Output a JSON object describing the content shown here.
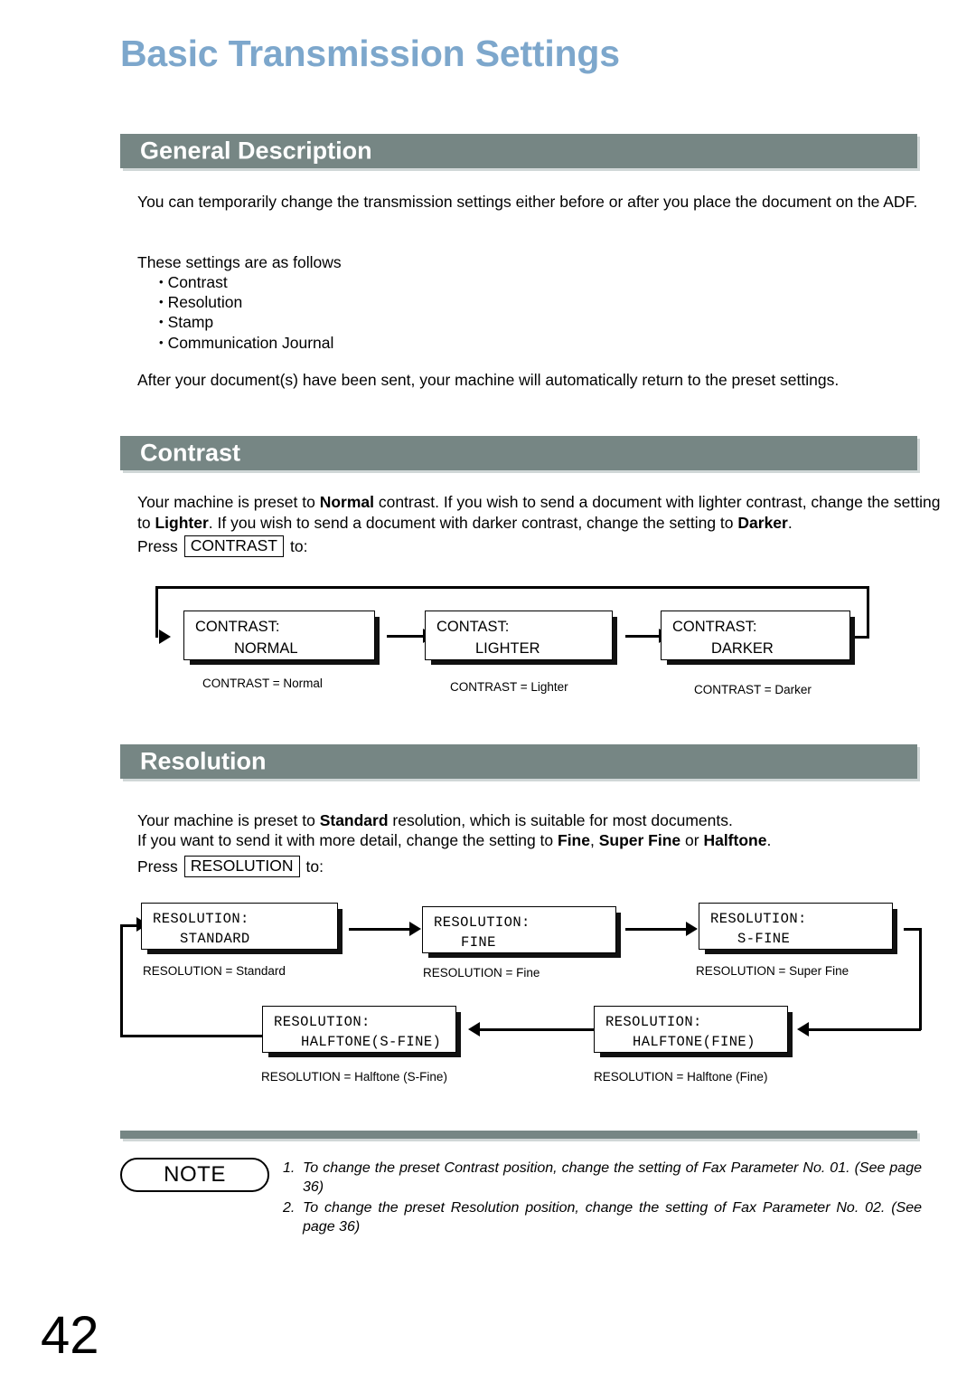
{
  "document": {
    "title": "Basic Transmission Settings",
    "page_number": "42",
    "accent_title_color": "#7da7cc",
    "section_bar_color": "#768684"
  },
  "sections": {
    "general_description": {
      "heading": "General Description",
      "paragraph1": "You can temporarily change the transmission settings either before or after you place the document on the ADF.",
      "paragraph2": "These settings are as follows",
      "bullets": [
        "Contrast",
        "Resolution",
        "Stamp",
        "Communication Journal"
      ],
      "paragraph3": "After your document(s) have been sent, your machine will automatically return to the preset settings."
    },
    "contrast": {
      "heading": "Contrast",
      "body_part1": "Your machine is preset to ",
      "body_bold1": "Normal",
      "body_part2": " contrast.  If you wish to send a document with lighter contrast, change the setting to ",
      "body_bold2": "Lighter",
      "body_part3": ".  If you wish to send a document with darker contrast, change the setting to ",
      "body_bold3": "Darker",
      "body_part4": ".",
      "press_prefix": "Press",
      "key_label": "CONTRAST",
      "press_suffix": "to:",
      "boxes": [
        {
          "line1": "CONTRAST:",
          "line2": "NORMAL",
          "caption": "CONTRAST = Normal"
        },
        {
          "line1": "CONTAST:",
          "line2": "LIGHTER",
          "caption": "CONTRAST = Lighter"
        },
        {
          "line1": "CONTRAST:",
          "line2": "DARKER",
          "caption": "CONTRAST = Darker"
        }
      ]
    },
    "resolution": {
      "heading": "Resolution",
      "body_line1_part1": "Your machine is preset to ",
      "body_line1_bold": "Standard",
      "body_line1_part2": " resolution, which is suitable for most documents.",
      "body_line2_part1": "If you want to send it with more detail, change the setting to ",
      "body_line2_bold1": "Fine",
      "body_line2_part2": ", ",
      "body_line2_bold2": "Super Fine",
      "body_line2_part3": " or ",
      "body_line2_bold3": "Halftone",
      "body_line2_part4": ".",
      "press_prefix": "Press",
      "key_label": "RESOLUTION",
      "press_suffix": "to:",
      "boxes": [
        {
          "line1": "RESOLUTION:",
          "line2": "STANDARD",
          "caption": "RESOLUTION = Standard"
        },
        {
          "line1": "RESOLUTION:",
          "line2": "FINE",
          "caption": "RESOLUTION = Fine"
        },
        {
          "line1": "RESOLUTION:",
          "line2": "S-FINE",
          "caption": "RESOLUTION = Super Fine"
        },
        {
          "line1": "RESOLUTION:",
          "line2": "HALFTONE(FINE)",
          "caption": "RESOLUTION = Halftone (Fine)"
        },
        {
          "line1": "RESOLUTION:",
          "line2": "HALFTONE(S-FINE)",
          "caption": "RESOLUTION = Halftone (S-Fine)"
        }
      ]
    }
  },
  "note": {
    "badge_label": "NOTE",
    "items": [
      {
        "num": "1.",
        "text": "To change the preset Contrast position, change the setting of Fax Parameter No. 01. (See page 36)"
      },
      {
        "num": "2.",
        "text": "To change the preset Resolution position, change the setting of Fax Parameter No. 02.  (See page 36)"
      }
    ]
  }
}
